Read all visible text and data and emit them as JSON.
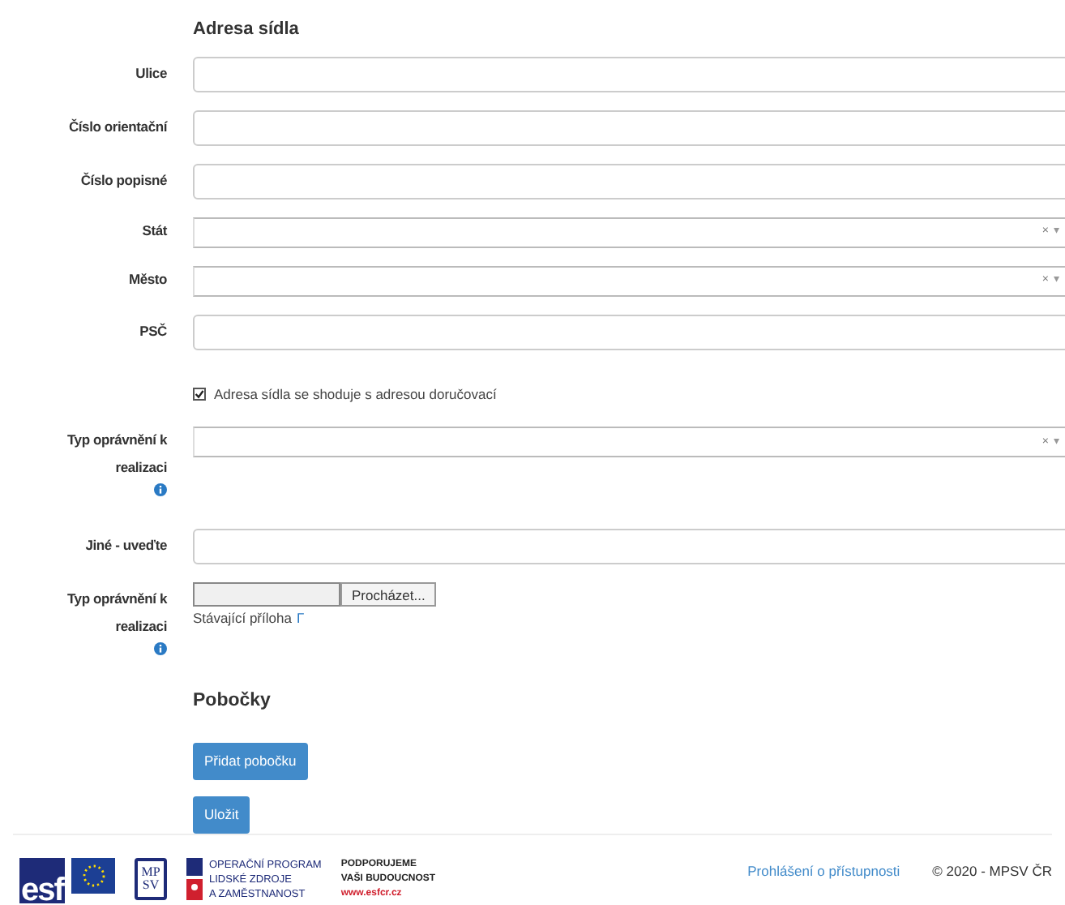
{
  "section_title": "Adresa sídla",
  "fields": [
    {
      "kind": "text",
      "label": "Ulice"
    },
    {
      "kind": "text",
      "label": "Číslo orientační"
    },
    {
      "kind": "text",
      "label": "Číslo popisné"
    },
    {
      "kind": "select",
      "label": "Stát",
      "clear": "×",
      "caret": "▾"
    },
    {
      "kind": "select",
      "label": "Město",
      "clear": "×",
      "caret": "▾"
    },
    {
      "kind": "text",
      "label": "PSČ"
    },
    {
      "kind": "checkbox",
      "label": "Adresa sídla se shoduje s adresou doručovací",
      "checked": true
    },
    {
      "kind": "select",
      "label": "Typ oprávnění k realizaci",
      "info": true,
      "clear": "×",
      "caret": "▾"
    },
    {
      "kind": "text",
      "label": "Jiné - uveďte"
    },
    {
      "kind": "file",
      "label": "Typ oprávnění k realizaci",
      "info": true,
      "button": "Procházet...",
      "existing": "Stávající příloha",
      "link": "Γ"
    }
  ],
  "branches_title": "Pobočky",
  "buttons": [
    "Přidat pobočku",
    "Uložit"
  ],
  "footer": {
    "logos": {
      "esf": "esf",
      "mpsv_top": "MP",
      "mpsv_bottom": "SV",
      "op_lines": [
        "OPERAČNÍ PROGRAM",
        "LIDSKÉ ZDROJE",
        "A ZAMĚSTNANOST"
      ],
      "support_lines": [
        "PODPORUJEME",
        "VAŠI BUDOUCNOST"
      ],
      "web": "www.esfcr.cz"
    },
    "accessibility_link": "Prohlášení o přístupnosti",
    "copyright": "© 2020 - MPSV ČR"
  }
}
